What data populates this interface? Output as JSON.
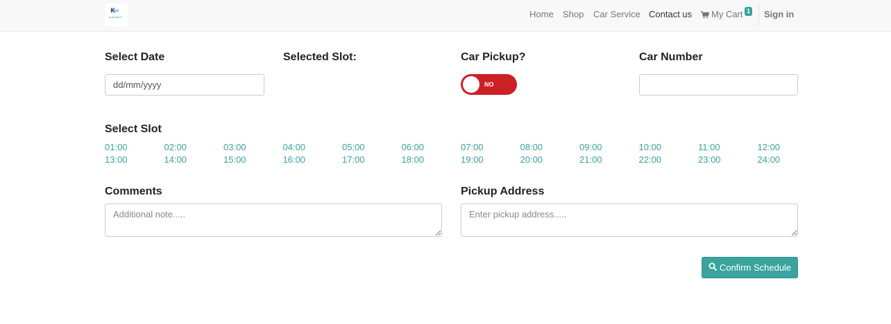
{
  "navbar": {
    "logo_text_main": "K",
    "logo_text_small": "ron",
    "logo_text_sub": "autosport",
    "links": [
      {
        "label": "Home"
      },
      {
        "label": "Shop"
      },
      {
        "label": "Car Service"
      },
      {
        "label": "Contact us"
      }
    ],
    "cart_label": "My Cart",
    "cart_count": "1",
    "signin_label": "Sign in",
    "accent_color": "#3aa39e"
  },
  "form": {
    "select_date_label": "Select Date",
    "date_placeholder": "dd/mm/yyyy",
    "selected_slot_label": "Selected Slot:",
    "car_pickup_label": "Car Pickup?",
    "car_pickup_toggle": "NO",
    "toggle_color": "#cc2027",
    "car_number_label": "Car Number",
    "car_number_value": "",
    "select_slot_label": "Select Slot",
    "slots_row1": [
      "01:00",
      "02:00",
      "03:00",
      "04:00",
      "05:00",
      "06:00",
      "07:00",
      "08:00",
      "09:00",
      "10:00",
      "11:00",
      "12:00"
    ],
    "slots_row2": [
      "13:00",
      "14:00",
      "15:00",
      "16:00",
      "17:00",
      "18:00",
      "19:00",
      "20:00",
      "21:00",
      "22:00",
      "23:00",
      "24:00"
    ],
    "comments_label": "Comments",
    "comments_placeholder": "Additional note.....",
    "pickup_address_label": "Pickup Address",
    "pickup_address_placeholder": "Enter pickup address.....",
    "confirm_button_label": "Confirm Schedule"
  }
}
